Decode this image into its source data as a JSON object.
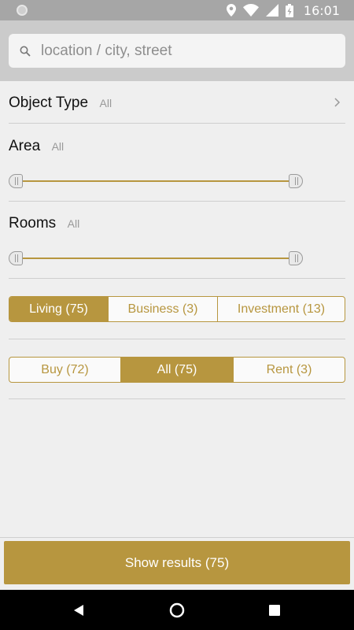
{
  "status_bar": {
    "time": "16:01",
    "icons": [
      "location-icon",
      "wifi-icon",
      "signal-icon",
      "battery-charging-icon"
    ]
  },
  "search": {
    "placeholder": "location / city, street",
    "value": ""
  },
  "filters": {
    "object_type": {
      "title": "Object Type",
      "value": "All"
    },
    "area": {
      "title": "Area",
      "value": "All",
      "range_min_fraction": 0,
      "range_max_fraction": 1
    },
    "rooms": {
      "title": "Rooms",
      "value": "All",
      "range_min_fraction": 0,
      "range_max_fraction": 1
    },
    "category": {
      "options": [
        "Living (75)",
        "Business (3)",
        "Investment (13)"
      ],
      "selected": "Living (75)"
    },
    "deal": {
      "options": [
        "Buy (72)",
        "All (75)",
        "Rent (3)"
      ],
      "selected": "All (75)"
    }
  },
  "show_results_label": "Show results (75)",
  "colors": {
    "accent": "#b7963f",
    "background": "#efefef",
    "header": "#cbcbcb"
  },
  "navbar": {
    "icons": [
      "back-icon",
      "home-icon",
      "recents-icon"
    ]
  }
}
